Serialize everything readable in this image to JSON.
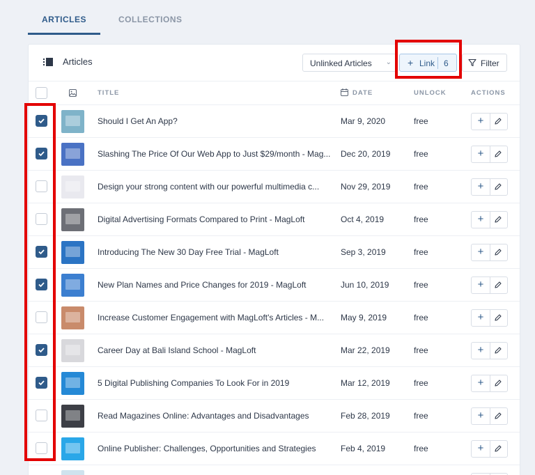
{
  "tabs": [
    {
      "label": "ARTICLES",
      "active": true
    },
    {
      "label": "COLLECTIONS",
      "active": false
    }
  ],
  "panel": {
    "title": "Articles",
    "filter_select": {
      "selected": "Unlinked Articles"
    },
    "link_button": {
      "label": "Link",
      "count": "6"
    },
    "filter_button": {
      "label": "Filter"
    }
  },
  "columns": {
    "title": "TITLE",
    "date": "DATE",
    "unlock": "UNLOCK",
    "actions": "ACTIONS"
  },
  "articles": [
    {
      "title": "Should I Get An App?",
      "date": "Mar 9, 2020",
      "unlock": "free",
      "checked": true,
      "thumb": "#7fb3c9"
    },
    {
      "title": "Slashing The Price Of Our Web App to Just $29/month - Mag...",
      "date": "Dec 20, 2019",
      "unlock": "free",
      "checked": true,
      "thumb": "#4a72c4"
    },
    {
      "title": "Design your strong content with our powerful multimedia c...",
      "date": "Nov 29, 2019",
      "unlock": "free",
      "checked": false,
      "thumb": "#e9e9ef"
    },
    {
      "title": "Digital Advertising Formats Compared to Print - MagLoft",
      "date": "Oct 4, 2019",
      "unlock": "free",
      "checked": false,
      "thumb": "#6d6f76"
    },
    {
      "title": "Introducing The New 30 Day Free Trial - MagLoft",
      "date": "Sep 3, 2019",
      "unlock": "free",
      "checked": true,
      "thumb": "#2b74c4"
    },
    {
      "title": "New Plan Names and Price Changes for 2019 - MagLoft",
      "date": "Jun 10, 2019",
      "unlock": "free",
      "checked": true,
      "thumb": "#3c7fd0"
    },
    {
      "title": "Increase Customer Engagement with MagLoft's Articles - M...",
      "date": "May 9, 2019",
      "unlock": "free",
      "checked": false,
      "thumb": "#c98b6b"
    },
    {
      "title": "Career Day at Bali Island School - MagLoft",
      "date": "Mar 22, 2019",
      "unlock": "free",
      "checked": true,
      "thumb": "#d8d8dc"
    },
    {
      "title": "5 Digital Publishing Companies To Look For in 2019",
      "date": "Mar 12, 2019",
      "unlock": "free",
      "checked": true,
      "thumb": "#2589d6"
    },
    {
      "title": "Read Magazines Online: Advantages and Disadvantages",
      "date": "Feb 28, 2019",
      "unlock": "free",
      "checked": false,
      "thumb": "#3d3f46"
    },
    {
      "title": "Online Publisher: Challenges, Opportunities and Strategies",
      "date": "Feb 4, 2019",
      "unlock": "free",
      "checked": false,
      "thumb": "#2aa7e8"
    },
    {
      "title": "",
      "date": "",
      "unlock": "",
      "checked": false,
      "thumb": "#cfe3ee"
    }
  ],
  "colors": {
    "accent": "#2f5b8a",
    "highlight": "#e30000"
  },
  "icons": {
    "panel": "list-icon",
    "image_column": "image-icon",
    "date_column": "calendar-icon",
    "filter": "filter-icon",
    "row_add": "plus-icon",
    "row_edit": "pencil-icon"
  }
}
